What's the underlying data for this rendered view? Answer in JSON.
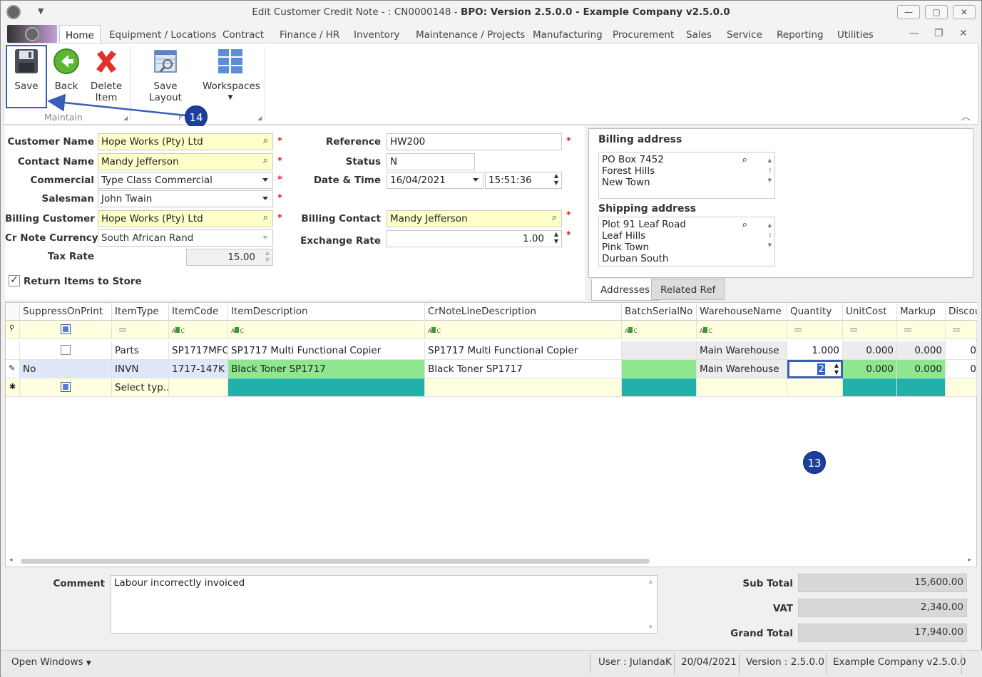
{
  "window": {
    "title_prefix": "Edit Customer Credit Note - : CN0000148 - ",
    "title_bold": "BPO: Version 2.5.0.0 - Example Company v2.5.0.0",
    "min": "—",
    "max": "▢",
    "close": "✕"
  },
  "menu_tabs": [
    "Home",
    "Equipment / Locations",
    "Contract",
    "Finance / HR",
    "Inventory",
    "Maintenance / Projects",
    "Manufacturing",
    "Procurement",
    "Sales",
    "Service",
    "Reporting",
    "Utilities"
  ],
  "ribbon": {
    "save": "Save",
    "back": "Back",
    "delete_l1": "Delete",
    "delete_l2": "Item",
    "save_layout": "Save Layout",
    "workspaces": "Workspaces",
    "group_maintain": "Maintain",
    "group_format": "F"
  },
  "markers": {
    "m14": "14",
    "m13": "13"
  },
  "form": {
    "customer_name_label": "Customer Name",
    "customer_name": "Hope Works (Pty) Ltd",
    "contact_name_label": "Contact Name",
    "contact_name": "Mandy Jefferson",
    "commercial_label": "Commercial",
    "commercial": "Type Class Commercial",
    "salesman_label": "Salesman",
    "salesman": "John Twain",
    "billing_customer_label": "Billing Customer",
    "billing_customer": "Hope Works (Pty) Ltd",
    "currency_label": "Cr Note Currency",
    "currency": "South African Rand",
    "tax_rate_label": "Tax Rate",
    "tax_rate": "15.00",
    "reference_label": "Reference",
    "reference": "HW200",
    "status_label": "Status",
    "status": "N",
    "datetime_label": "Date & Time",
    "date": "16/04/2021",
    "time": "15:51:36",
    "billing_contact_label": "Billing Contact",
    "billing_contact": "Mandy Jefferson",
    "exchange_rate_label": "Exchange Rate",
    "exchange_rate": "1.00",
    "return_items_label": "Return Items to Store",
    "required": "*"
  },
  "addresses": {
    "billing_title": "Billing address",
    "billing_lines": [
      "PO Box 7452",
      "Forest Hills",
      "New Town"
    ],
    "shipping_title": "Shipping address",
    "shipping_lines": [
      "Plot 91 Leaf Road",
      "Leaf Hills",
      "Pink Town",
      "Durban South"
    ],
    "tab_addresses": "Addresses",
    "tab_related": "Related Ref"
  },
  "grid": {
    "columns": [
      "SuppressOnPrint",
      "ItemType",
      "ItemCode",
      "ItemDescription",
      "CrNoteLineDescription",
      "BatchSerialNo",
      "WarehouseName",
      "Quantity",
      "UnitCost",
      "Markup",
      "Discou"
    ],
    "rows": [
      {
        "suppress": "",
        "type": "Parts",
        "code": "SP1717MFC",
        "desc": "SP1717 Multi Functional Copier",
        "line_desc": "SP1717 Multi Functional Copier",
        "batch": "",
        "warehouse": "Main Warehouse",
        "qty": "1.000",
        "unit_cost": "0.000",
        "markup": "0.000",
        "disc": "0"
      },
      {
        "suppress": "No",
        "type": "INVN",
        "code": "1717-147K",
        "desc": "Black Toner SP1717",
        "line_desc": "Black Toner SP1717",
        "batch": "",
        "warehouse": "Main Warehouse",
        "qty": "2",
        "unit_cost": "0.000",
        "markup": "0.000",
        "disc": "0"
      }
    ],
    "new_row_type": "Select typ..."
  },
  "totals": {
    "comment_label": "Comment",
    "comment": "Labour incorrectly invoiced",
    "subtotal_label": "Sub Total",
    "subtotal": "15,600.00",
    "vat_label": "VAT",
    "vat": "2,340.00",
    "grand_total_label": "Grand Total",
    "grand_total": "17,940.00"
  },
  "statusbar": {
    "open_windows": "Open Windows",
    "user": "User : JulandaK",
    "date": "20/04/2021",
    "version": "Version : 2.5.0.0",
    "company": "Example Company v2.5.0.0"
  },
  "colors": {
    "accent": "#3b5db8",
    "marker": "#1d3f9c",
    "required": "#e02020",
    "green_cell": "#8ee68e",
    "teal_cell": "#20b2aa"
  }
}
